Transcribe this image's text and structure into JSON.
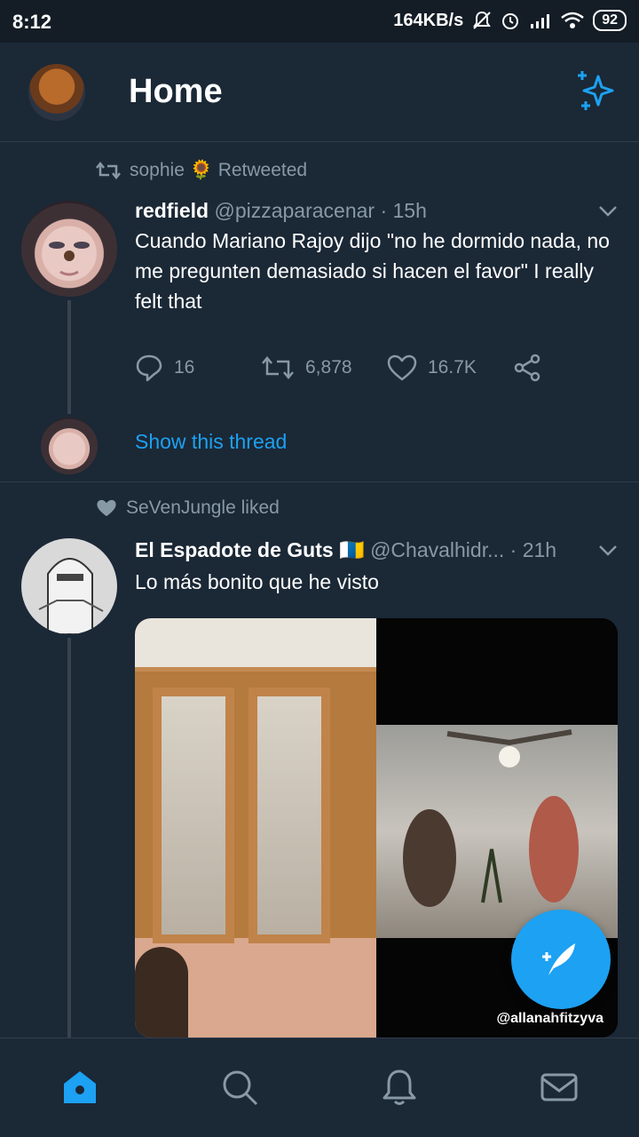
{
  "status_bar": {
    "time": "8:12",
    "network_speed": "164KB/s",
    "battery": "92"
  },
  "header": {
    "title": "Home"
  },
  "tweets": [
    {
      "context_text": "sophie 🌻 Retweeted",
      "name": "redfield",
      "handle": "@pizzaparacenar",
      "time": "· 15h",
      "text": "Cuando Mariano Rajoy dijo \"no he dormido nada, no me pregunten demasiado si hacen el favor\" I really felt that",
      "replies": "16",
      "retweets": "6,878",
      "likes": "16.7K",
      "show_thread": "Show this thread"
    },
    {
      "context_text": "SeVenJungle liked",
      "name": "El Espadote de Guts",
      "flag": "🇮🇨",
      "handle": "@Chavalhidr...",
      "time": "· 21h",
      "text": "Lo más bonito que he visto",
      "media_username": "@allanahfitzyva"
    }
  ],
  "colors": {
    "background": "#1b2836",
    "accent": "#1da1f2",
    "secondary_text": "#8899a6"
  }
}
